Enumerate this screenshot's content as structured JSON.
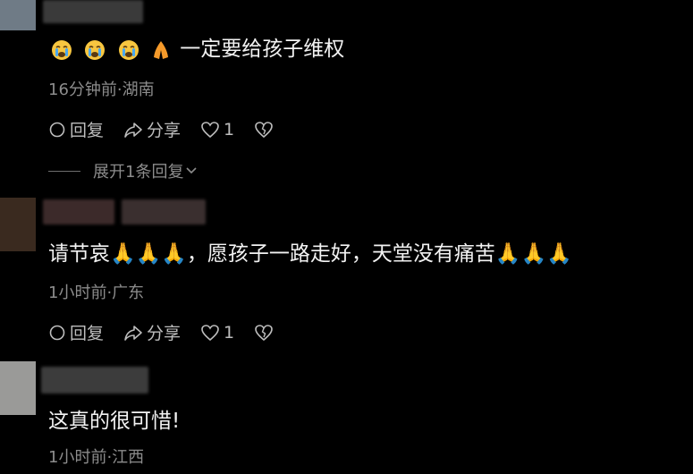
{
  "comments": [
    {
      "text_prefix": "😭😭😭🙏",
      "text": "一定要给孩子维权",
      "meta": "16分钟前·湖南",
      "reply_label": "回复",
      "share_label": "分享",
      "like_count": "1",
      "expand_label": "展开1条回复"
    },
    {
      "text": "请节哀🙏🙏🙏，愿孩子一路走好，天堂没有痛苦🙏🙏🙏",
      "meta": "1小时前·广东",
      "reply_label": "回复",
      "share_label": "分享",
      "like_count": "1"
    },
    {
      "text": "这真的很可惜!",
      "meta": "1小时前·江西"
    }
  ],
  "icons": [
    "sad-cry-emoji",
    "pray-emoji",
    "comment-icon",
    "share-icon",
    "heart-icon",
    "dislike-heart-icon",
    "chevron-down-icon"
  ],
  "colors": {
    "background": "#000000",
    "text": "#f2f2f2",
    "meta": "#8c8c8c",
    "actions": "#bdbdbd"
  }
}
